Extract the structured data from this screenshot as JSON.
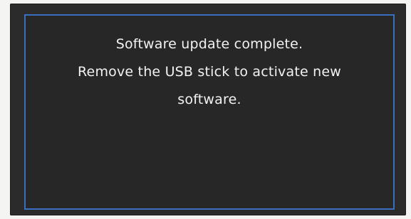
{
  "dialog": {
    "lines": [
      "Software update complete.",
      "Remove the USB stick to activate new",
      "software."
    ]
  },
  "colors": {
    "background": "#2b2b2b",
    "border": "#3a6fbf",
    "text": "#f2f2f2"
  }
}
